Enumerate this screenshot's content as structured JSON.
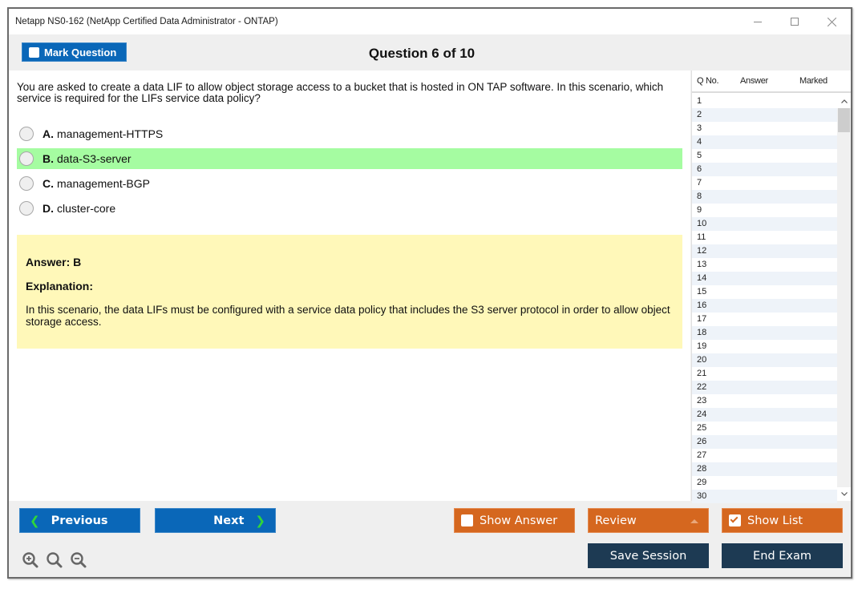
{
  "window": {
    "title": "Netapp NS0-162 (NetApp Certified Data Administrator - ONTAP)",
    "controls": {
      "minimize": "minimize",
      "maximize": "maximize",
      "close": "close"
    }
  },
  "toolbar": {
    "mark_question_label": "Mark Question",
    "mark_question_checked": false,
    "question_header": "Question 6 of 10"
  },
  "question": {
    "text": "You are asked to create a data LIF to allow object storage access to a bucket that is hosted in ON TAP software. In this scenario, which service is required for the LIFs service data policy?",
    "options": [
      {
        "letter": "A.",
        "text": "management-HTTPS",
        "correct": false
      },
      {
        "letter": "B.",
        "text": "data-S3-server",
        "correct": true
      },
      {
        "letter": "C.",
        "text": "management-BGP",
        "correct": false
      },
      {
        "letter": "D.",
        "text": "cluster-core",
        "correct": false
      }
    ],
    "highlight_color": "#a5fca1"
  },
  "answer": {
    "answer_label": "Answer: B",
    "explanation_heading": "Explanation:",
    "explanation_text": "In this scenario, the data LIFs must be configured with a service data policy that includes the S3 server protocol in order to allow object storage access.",
    "background_color": "#fff8b9"
  },
  "question_list": {
    "headers": [
      "Q No.",
      "Answer",
      "Marked"
    ],
    "rows": [
      "1",
      "2",
      "3",
      "4",
      "5",
      "6",
      "7",
      "8",
      "9",
      "10",
      "11",
      "12",
      "13",
      "14",
      "15",
      "16",
      "17",
      "18",
      "19",
      "20",
      "21",
      "22",
      "23",
      "24",
      "25",
      "26",
      "27",
      "28",
      "29",
      "30"
    ]
  },
  "footer": {
    "previous_label": "Previous",
    "next_label": "Next",
    "show_answer_label": "Show Answer",
    "show_answer_checked": false,
    "review_label": "Review",
    "show_list_label": "Show List",
    "show_list_checked": true,
    "save_session_label": "Save Session",
    "end_exam_label": "End Exam",
    "zoom_icons": [
      "zoom-in",
      "zoom-reset",
      "zoom-out"
    ]
  },
  "colors": {
    "primary_blue": "#0a67b8",
    "accent_orange": "#d5671f",
    "dark_navy": "#1d3a53",
    "chevron_green": "#2fd63a"
  }
}
